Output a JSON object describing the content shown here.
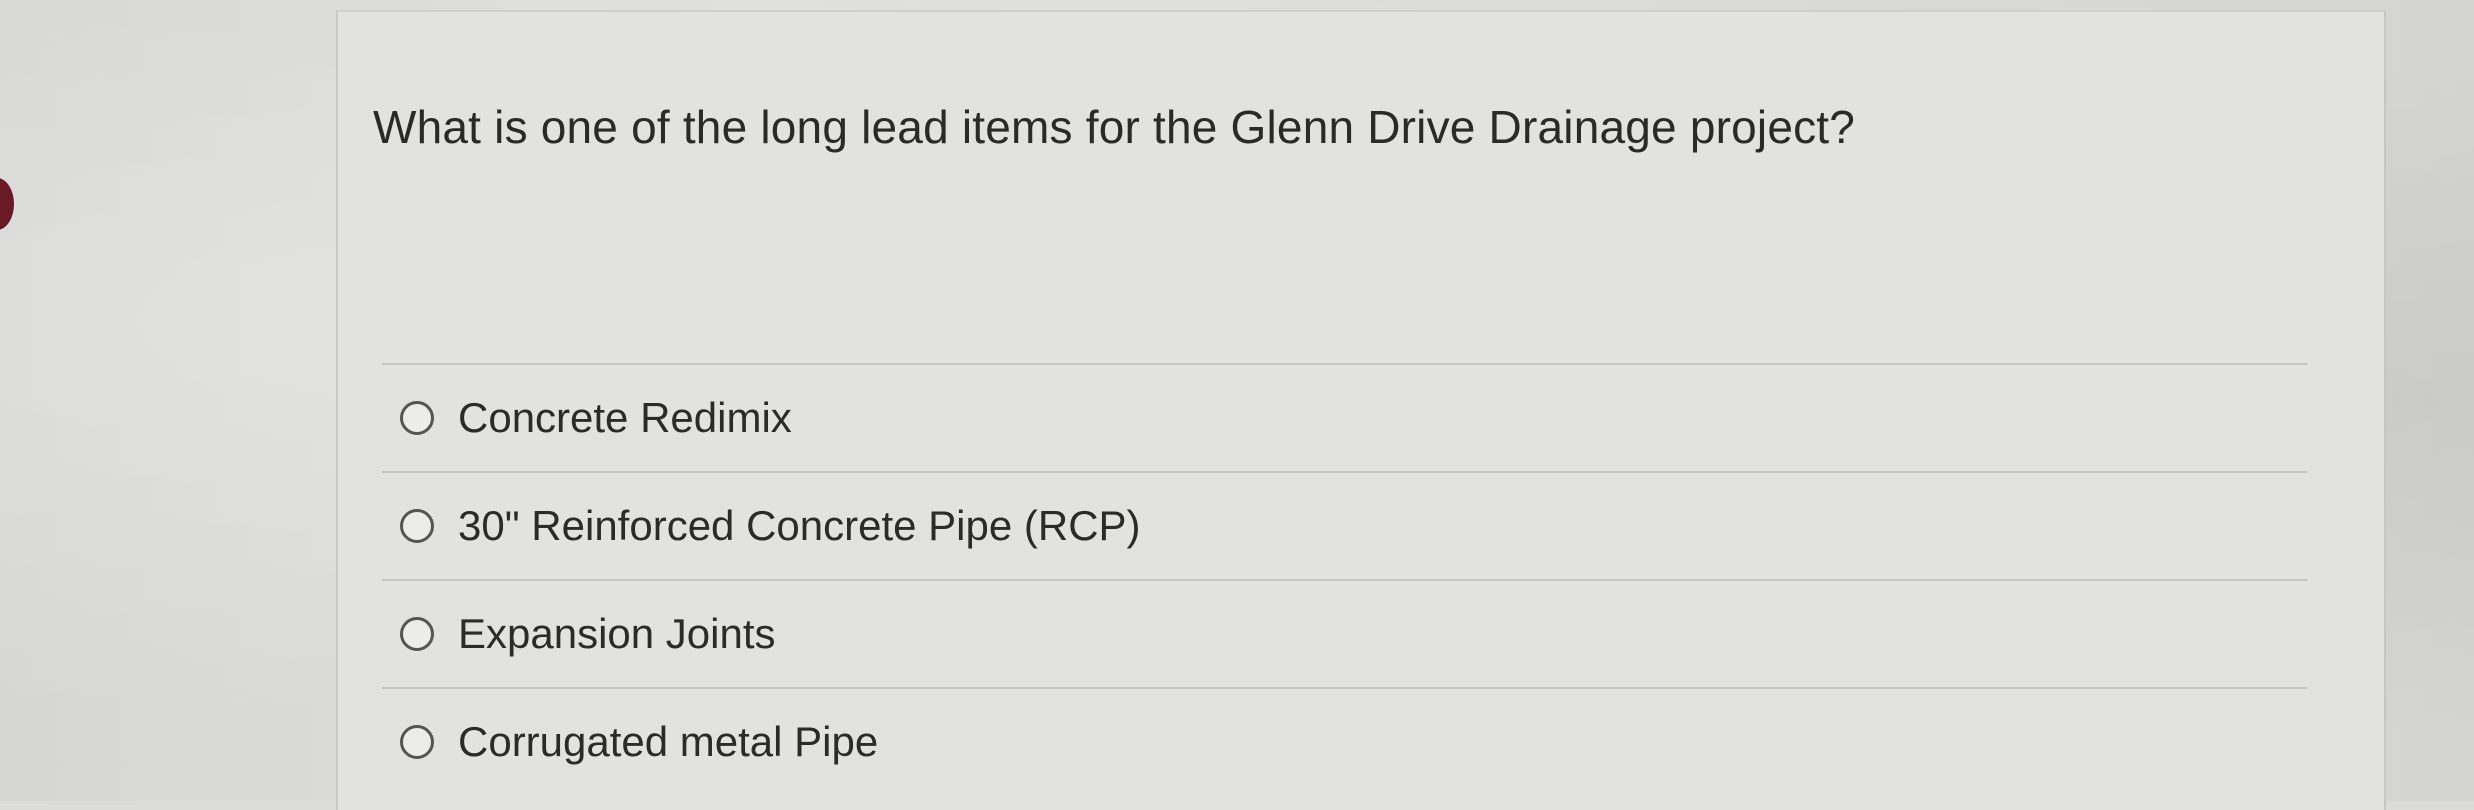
{
  "question": {
    "text": "What is one of the long lead items for the Glenn Drive Drainage project?"
  },
  "options": [
    {
      "label": "Concrete Redimix",
      "selected": false
    },
    {
      "label": "30\" Reinforced Concrete Pipe (RCP)",
      "selected": false
    },
    {
      "label": "Expansion Joints",
      "selected": false
    },
    {
      "label": "Corrugated metal Pipe",
      "selected": false
    }
  ],
  "colors": {
    "background": "#dcdcda",
    "card": "#e2e2e0",
    "text": "#2b2b2b",
    "marker": "#6a1a24"
  }
}
